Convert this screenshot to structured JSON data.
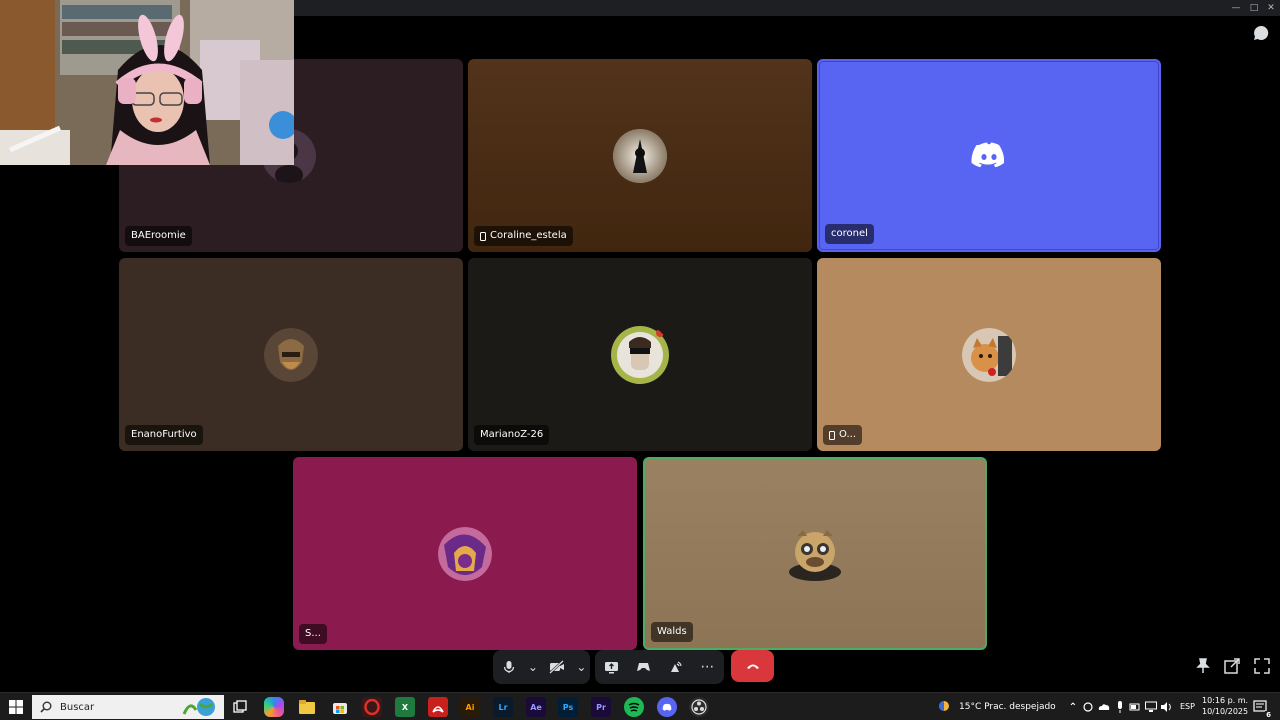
{
  "window": {
    "minimize_icon": "minimize-icon",
    "maximize_icon": "maximize-icon",
    "close_icon": "close-icon"
  },
  "participants": [
    {
      "name": "BAEroomie",
      "bg": "#2b1d22",
      "mobile": false
    },
    {
      "name": "Coraline_estela",
      "bg": "#4a2d17",
      "mobile": true
    },
    {
      "name": "coronel",
      "bg": "#5865f2",
      "mobile": false
    },
    {
      "name": "EnanoFurtivo",
      "bg": "#3b2d23",
      "mobile": false
    },
    {
      "name": "MarianoZ-26",
      "bg": "#1b1a17",
      "mobile": false
    },
    {
      "name": "O...",
      "bg": "#b58a5e",
      "mobile": true
    },
    {
      "name": "S...",
      "bg": "#8b1b4f",
      "mobile": false
    },
    {
      "name": "Walds",
      "bg": "#9a8162",
      "mobile": false
    }
  ],
  "colors": {
    "discord_blurple": "#5865f2",
    "speaking_green": "#4dab62",
    "hangup_red": "#da373c"
  },
  "controls": {
    "icons": [
      "microphone-icon",
      "chevron-down-icon",
      "camera-off-icon",
      "chevron-down-icon",
      "screen-share-icon",
      "activities-icon",
      "soundboard-icon",
      "more-options-icon",
      "hang-up-icon"
    ]
  },
  "taskbar": {
    "search_placeholder": "Buscar",
    "weather": "15°C  Prac. despejado",
    "language": "ESP",
    "time": "10:16 p. m.",
    "date": "10/10/2025",
    "notification_count": "6",
    "apps": [
      {
        "icon": "task-view-icon",
        "label": ""
      },
      {
        "icon": "copilot-icon",
        "label": ""
      },
      {
        "icon": "file-explorer-icon",
        "label": ""
      },
      {
        "icon": "microsoft-store-icon",
        "label": ""
      },
      {
        "icon": "opera-icon",
        "label": ""
      },
      {
        "icon": "excel-icon",
        "label": "X"
      },
      {
        "icon": "acrobat-icon",
        "label": ""
      },
      {
        "icon": "illustrator-icon",
        "label": "Ai"
      },
      {
        "icon": "lightroom-icon",
        "label": "Lr"
      },
      {
        "icon": "after-effects-icon",
        "label": "Ae"
      },
      {
        "icon": "photoshop-icon",
        "label": "Ps"
      },
      {
        "icon": "premiere-icon",
        "label": "Pr"
      },
      {
        "icon": "spotify-icon",
        "label": ""
      },
      {
        "icon": "discord-icon",
        "label": ""
      },
      {
        "icon": "obs-icon",
        "label": ""
      }
    ]
  }
}
